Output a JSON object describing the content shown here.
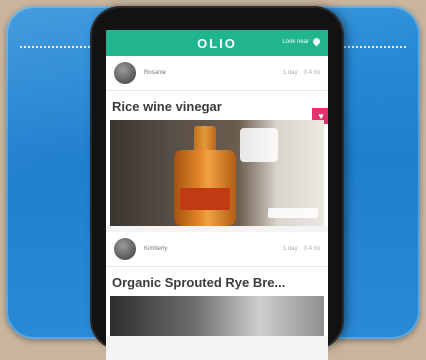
{
  "app": {
    "brand": "OLIO",
    "location": "Look near"
  },
  "listings": [
    {
      "user": "Rosanie",
      "time": "1 day",
      "distance": "0.4 mi",
      "title": "Rice wine vinegar"
    },
    {
      "user": "Kimberly",
      "time": "1 day",
      "distance": "0.4 mi",
      "title": "Organic Sprouted Rye Bre..."
    }
  ],
  "colors": {
    "brand_green": "#21b58f",
    "background_blue": "#2b8fd8",
    "like_pink": "#e2336f"
  },
  "icons": [
    "location-pin-icon",
    "heart-icon"
  ]
}
